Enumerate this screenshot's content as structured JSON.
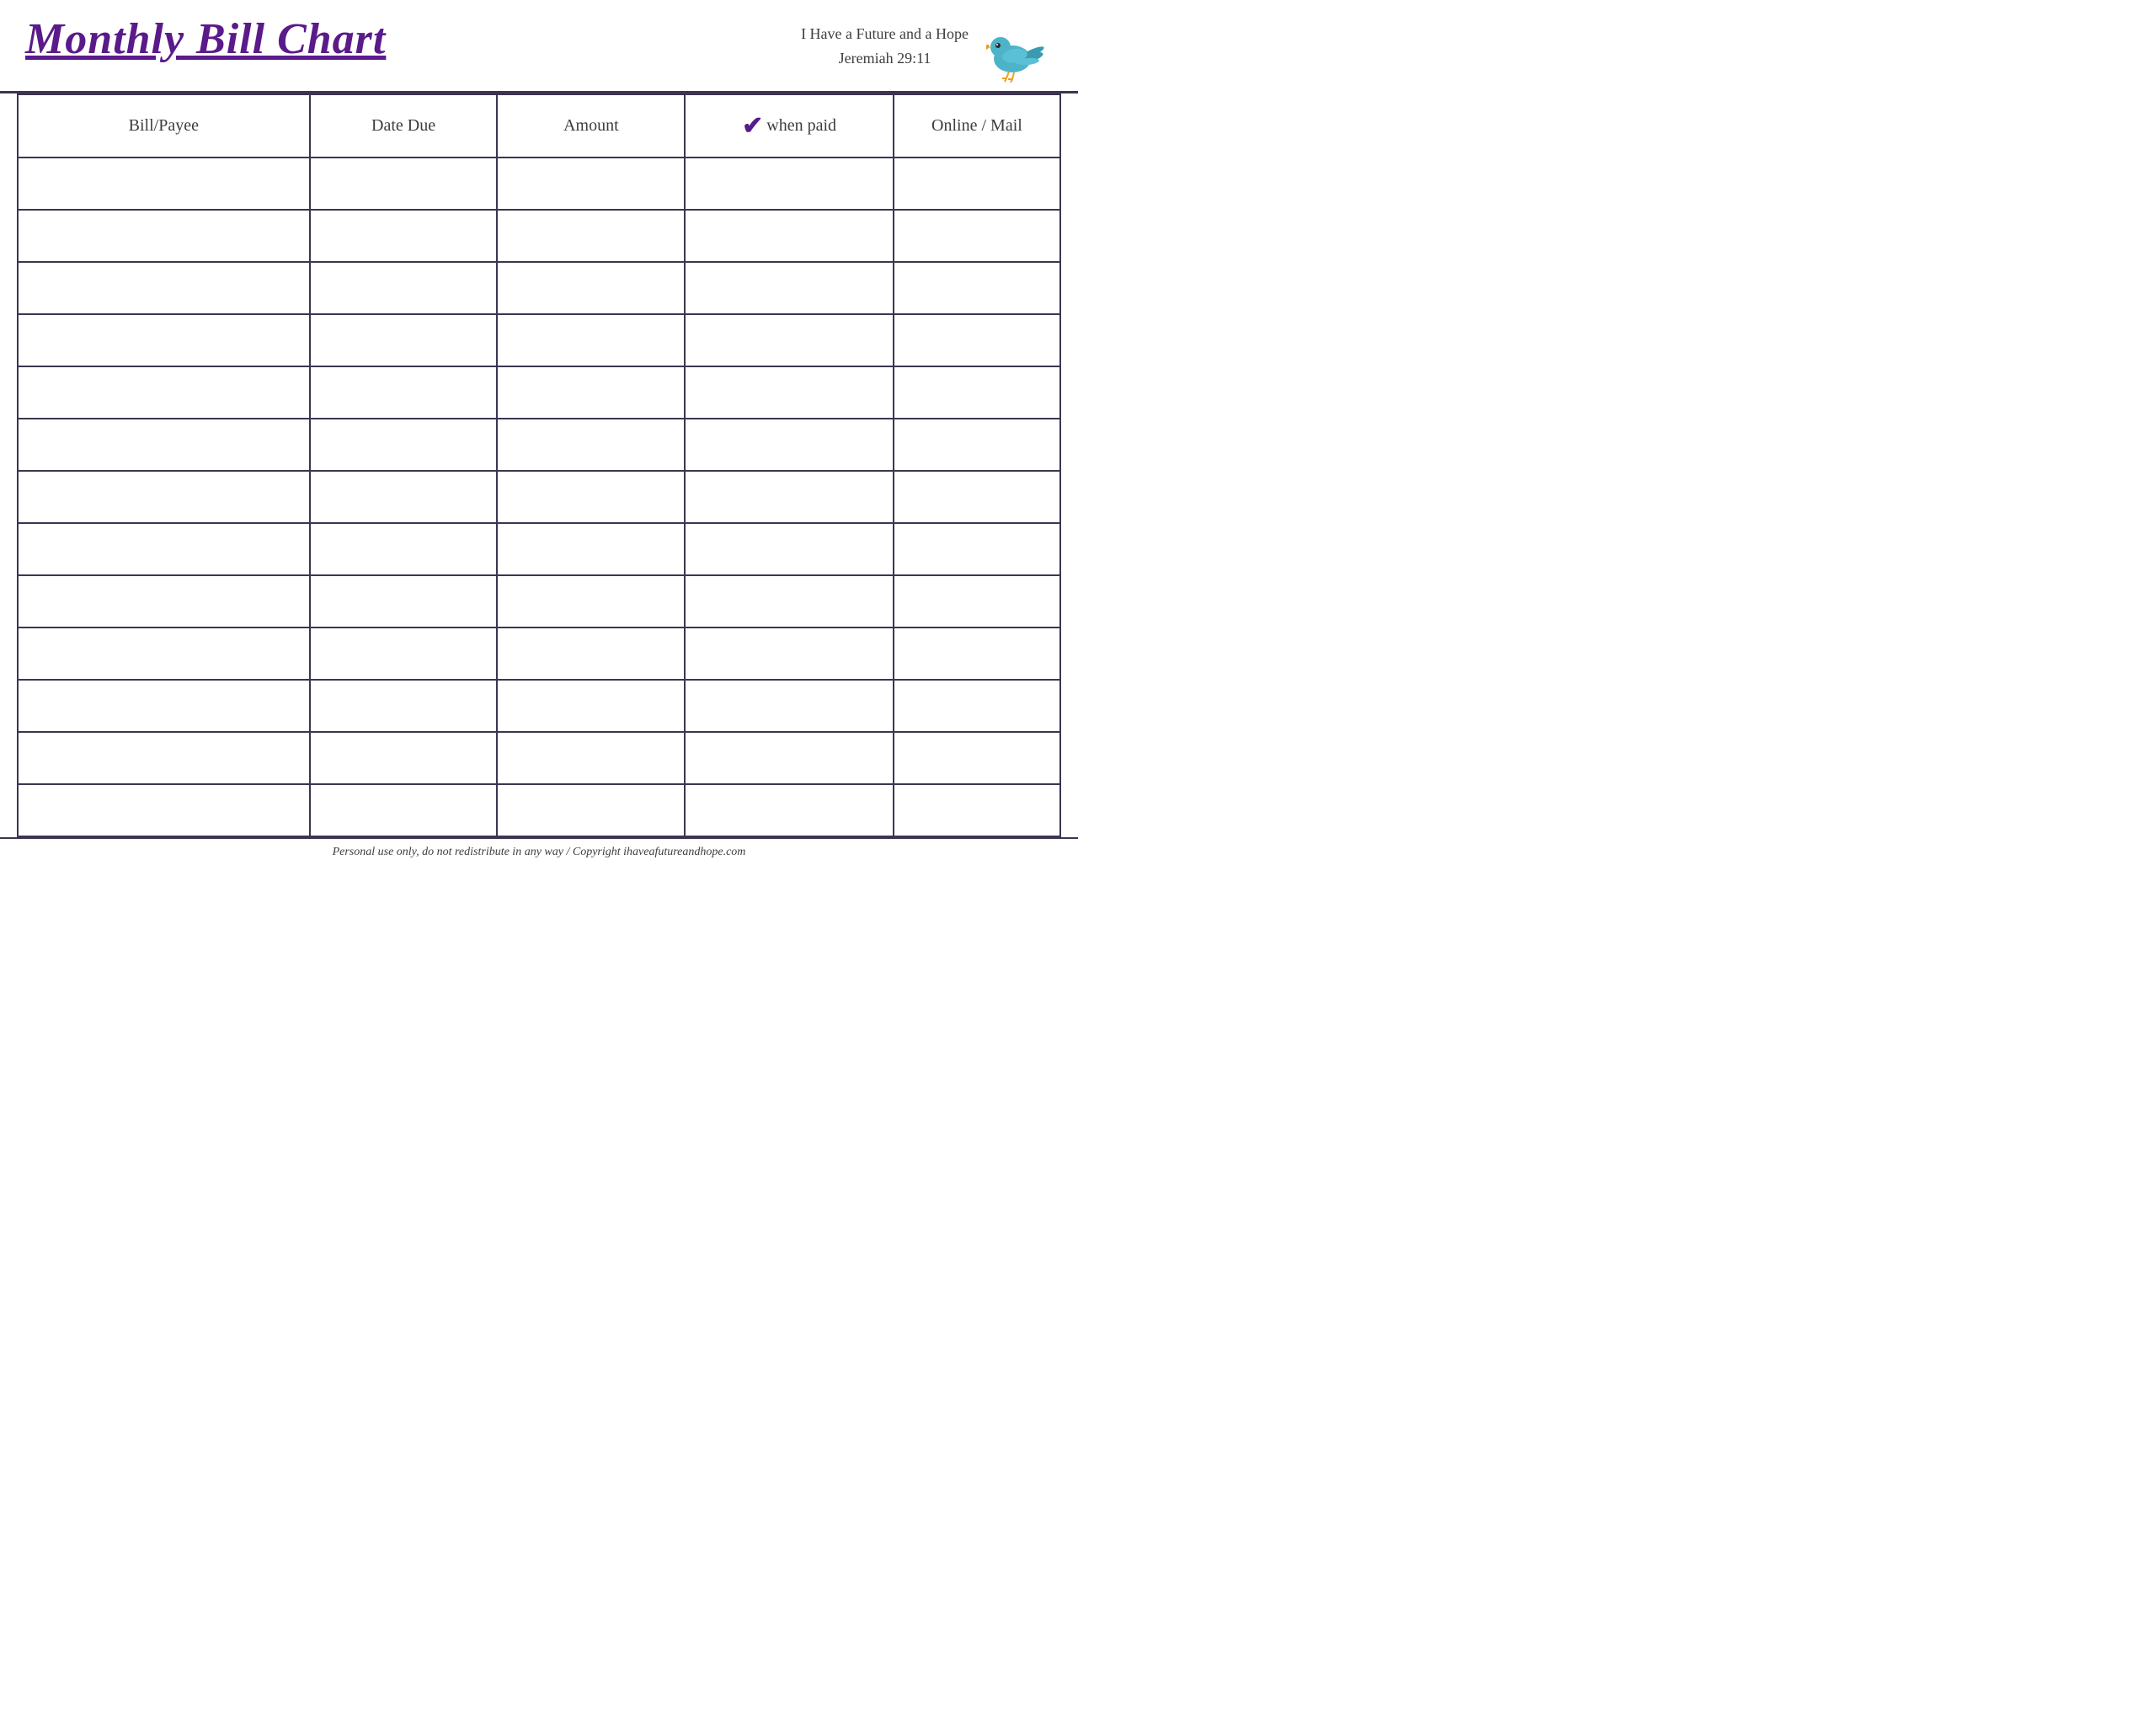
{
  "header": {
    "title": "Monthly Bill Chart",
    "scripture_line1": "I Have a Future and a Hope",
    "scripture_line2": "Jeremiah 29:11"
  },
  "table": {
    "columns": [
      {
        "key": "payee",
        "label": "Bill/Payee"
      },
      {
        "key": "date",
        "label": "Date Due"
      },
      {
        "key": "amount",
        "label": "Amount"
      },
      {
        "key": "check",
        "label": "when paid",
        "checkmark": "✔"
      },
      {
        "key": "online",
        "label": "Online / Mail"
      }
    ],
    "row_count": 13
  },
  "footer": {
    "text": "Personal use only, do not redistribute in any way / Copyright ihaveafutureandhope.com"
  }
}
